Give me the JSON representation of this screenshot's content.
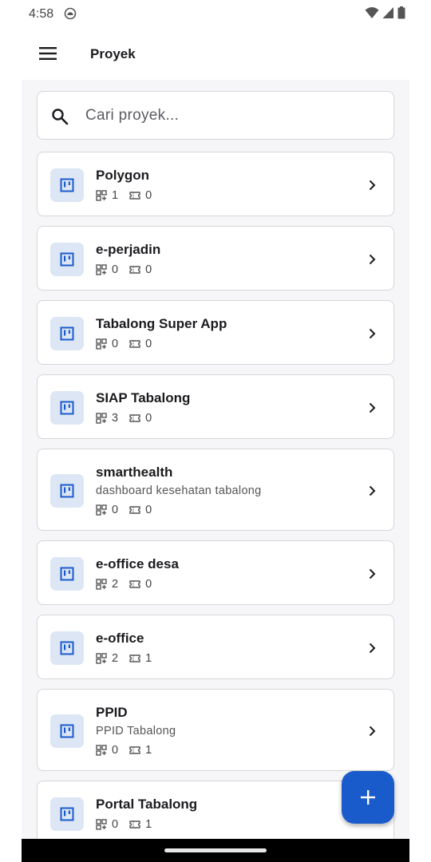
{
  "status_bar": {
    "time": "4:58"
  },
  "app_bar": {
    "title": "Proyek"
  },
  "search": {
    "placeholder": "Cari proyek..."
  },
  "projects": [
    {
      "name": "Polygon",
      "description": "",
      "boards": "1",
      "tickets": "0"
    },
    {
      "name": "e-perjadin",
      "description": "",
      "boards": "0",
      "tickets": "0"
    },
    {
      "name": "Tabalong Super App",
      "description": "",
      "boards": "0",
      "tickets": "0"
    },
    {
      "name": "SIAP Tabalong",
      "description": "",
      "boards": "3",
      "tickets": "0"
    },
    {
      "name": "smarthealth",
      "description": "dashboard kesehatan tabalong",
      "boards": "0",
      "tickets": "0"
    },
    {
      "name": "e-office desa",
      "description": "",
      "boards": "2",
      "tickets": "0"
    },
    {
      "name": "e-office",
      "description": "",
      "boards": "2",
      "tickets": "1"
    },
    {
      "name": "PPID",
      "description": "PPID Tabalong",
      "boards": "0",
      "tickets": "1"
    },
    {
      "name": "Portal Tabalong",
      "description": "",
      "boards": "0",
      "tickets": "1"
    }
  ],
  "icons": {
    "menu": "hamburger-menu-icon",
    "search": "search-icon",
    "project": "kanban-board-icon",
    "boards": "boards-grid-icon",
    "tickets": "ticket-icon",
    "chevron": "chevron-right-icon",
    "add": "plus-icon"
  },
  "colors": {
    "accent": "#1a5bcc",
    "icon_bg": "#dde6f4",
    "background": "#f6f6f9"
  }
}
